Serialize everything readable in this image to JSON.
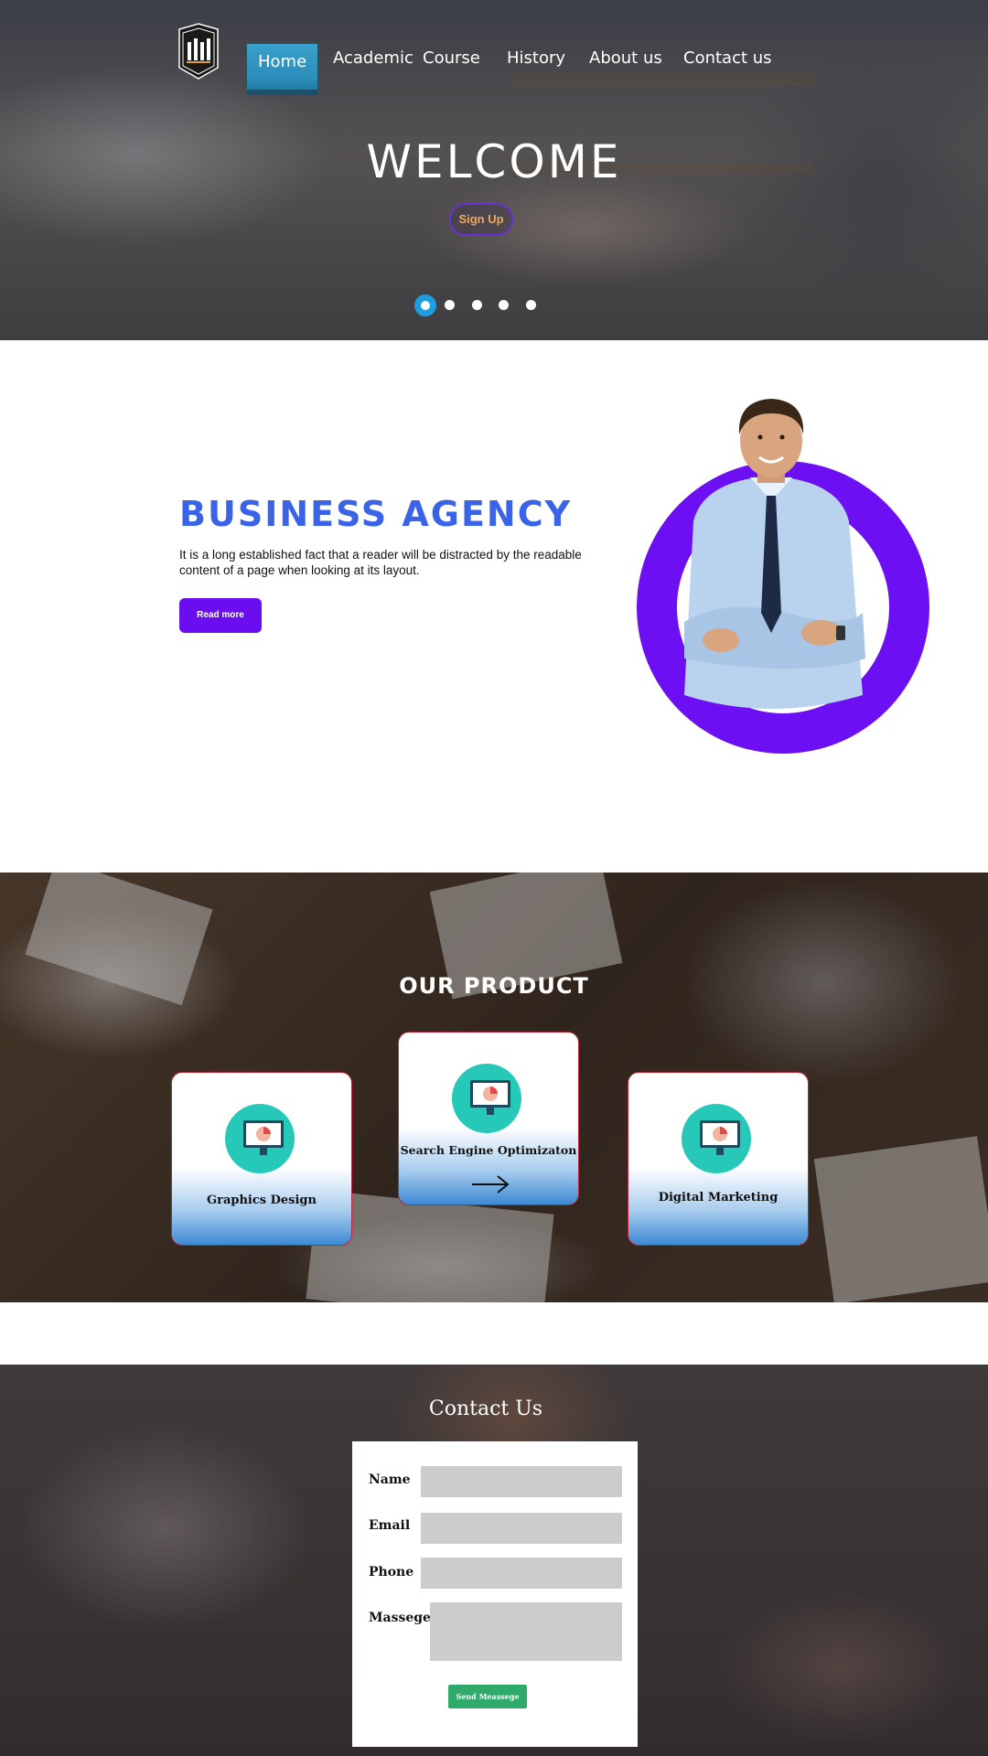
{
  "nav": {
    "items": [
      {
        "label": "Home",
        "active": true
      },
      {
        "label": "Academic"
      },
      {
        "label": "Course"
      },
      {
        "label": "History"
      },
      {
        "label": "About us"
      },
      {
        "label": "Contact us"
      }
    ]
  },
  "hero": {
    "title": "WELCOME",
    "signup_label": "Sign Up",
    "slides_total": 5,
    "active_slide": 1
  },
  "agency": {
    "title": "BUSINESS AGENCY",
    "text": "It is a long established fact that a reader will be distracted by the readable content of a page when looking at its layout.",
    "button_label": "Read more"
  },
  "product": {
    "title": "OUR PRODUCT",
    "cards": [
      {
        "label": "Graphics Design",
        "icon": "monitor-pie-chart-icon"
      },
      {
        "label": "Search Engine Optimizaton",
        "icon": "monitor-pie-chart-icon"
      },
      {
        "label": "Digital Marketing",
        "icon": "monitor-pie-chart-icon"
      }
    ]
  },
  "contact": {
    "title": "Contact Us",
    "fields": [
      {
        "label": "Name",
        "value": ""
      },
      {
        "label": "Email",
        "value": ""
      },
      {
        "label": "Phone",
        "value": ""
      },
      {
        "label": "Massege",
        "value": ""
      }
    ],
    "send_label": "Send Meassege"
  },
  "colors": {
    "nav_active": "#2b8cb8",
    "agency_title": "#3a63e8",
    "accent_purple": "#6c0ff2",
    "card_border": "#c0243a",
    "card_gradient_bottom": "#3d8ad4",
    "icon_teal": "#26c9b8",
    "send_button": "#2faa6a",
    "signup_text": "#f2a65a"
  }
}
